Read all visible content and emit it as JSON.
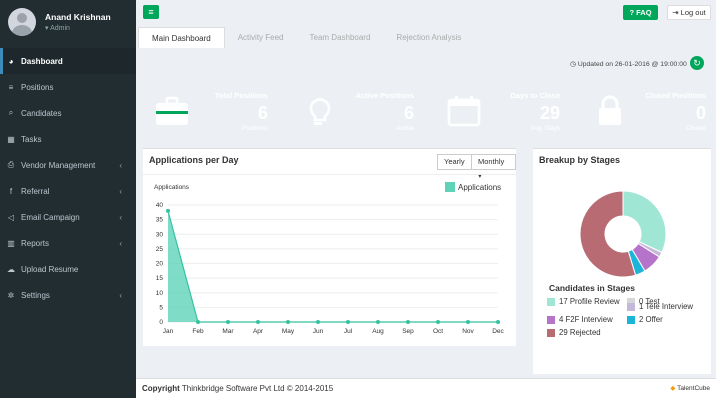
{
  "user": {
    "name": "Anand Krishnan",
    "role": "Admin"
  },
  "nav": [
    {
      "label": "Dashboard",
      "icon": "dashboard-icon",
      "active": true
    },
    {
      "label": "Positions",
      "icon": "list-icon"
    },
    {
      "label": "Candidates",
      "icon": "search-icon"
    },
    {
      "label": "Tasks",
      "icon": "calendar-icon"
    },
    {
      "label": "Vendor Management",
      "icon": "print-icon",
      "caret": "‹"
    },
    {
      "label": "Referral",
      "icon": "facebook-icon",
      "caret": "‹"
    },
    {
      "label": "Email Campaign",
      "icon": "bullhorn-icon",
      "caret": "‹"
    },
    {
      "label": "Reports",
      "icon": "bar-chart-icon",
      "caret": "‹"
    },
    {
      "label": "Upload Resume",
      "icon": "cloud-upload-icon"
    },
    {
      "label": "Settings",
      "icon": "gear-icon",
      "caret": "‹"
    }
  ],
  "topbar": {
    "faq_label": "FAQ",
    "logout_label": "Log out"
  },
  "tabs": [
    "Main Dashboard",
    "Activity Feed",
    "Team Dashboard",
    "Rejection Analysis"
  ],
  "updated": "Updated on 26-01-2016 @ 19:00:00",
  "stats": [
    {
      "title": "Total Positions",
      "value": "6",
      "sub": "Positions",
      "color": "#00a65a",
      "icon": "briefcase-icon"
    },
    {
      "title": "Active Positions",
      "value": "6",
      "sub": "Active",
      "color": "#f39c12",
      "icon": "lightbulb-icon"
    },
    {
      "title": "Days to Close",
      "value": "29",
      "sub": "Avg. Days",
      "color": "#00c0ef",
      "icon": "calendar-icon"
    },
    {
      "title": "Closed Positions",
      "value": "0",
      "sub": "Closed",
      "color": "#dd4b39",
      "icon": "lock-icon"
    }
  ],
  "apps_panel": {
    "title": "Applications per Day",
    "btn_yearly": "Yearly",
    "btn_monthly": "Monthly ▾"
  },
  "stages_panel": {
    "title": "Breakup by Stages",
    "subtitle": "Candidates in Stages"
  },
  "chart_data": [
    {
      "type": "area",
      "title": "",
      "ylabel": "Applications",
      "xlabel": "",
      "categories": [
        "Jan",
        "Feb",
        "Mar",
        "Apr",
        "May",
        "Jun",
        "Jul",
        "Aug",
        "Sep",
        "Oct",
        "Nov",
        "Dec"
      ],
      "series": [
        {
          "name": "Applications",
          "values": [
            38,
            0,
            0,
            0,
            0,
            0,
            0,
            0,
            0,
            0,
            0,
            0
          ],
          "color": "#5fd3b8"
        }
      ],
      "ylim": [
        0,
        40
      ],
      "yticks": [
        0,
        5,
        10,
        15,
        20,
        25,
        30,
        35,
        40
      ],
      "grid": true,
      "legend": "top-right"
    },
    {
      "type": "pie",
      "title": "Candidates in Stages",
      "slices": [
        {
          "label": "17 Profile Review",
          "value": 17,
          "color": "#a0e6d5"
        },
        {
          "label": "0 Test",
          "value": 0,
          "color": "#d7d7d7"
        },
        {
          "label": "1 Tele Interview",
          "value": 1,
          "color": "#c5b8d8"
        },
        {
          "label": "4 F2F Interview",
          "value": 4,
          "color": "#b574c9"
        },
        {
          "label": "2 Offer",
          "value": 2,
          "color": "#1ab5d8"
        },
        {
          "label": "29 Rejected",
          "value": 29,
          "color": "#b86b73"
        }
      ],
      "legend": "bottom"
    }
  ],
  "footer": {
    "copyright_label": "Copyright",
    "text": "Thinkbridge Software Pvt Ltd © 2014-2015",
    "brand": "TalentCube"
  }
}
